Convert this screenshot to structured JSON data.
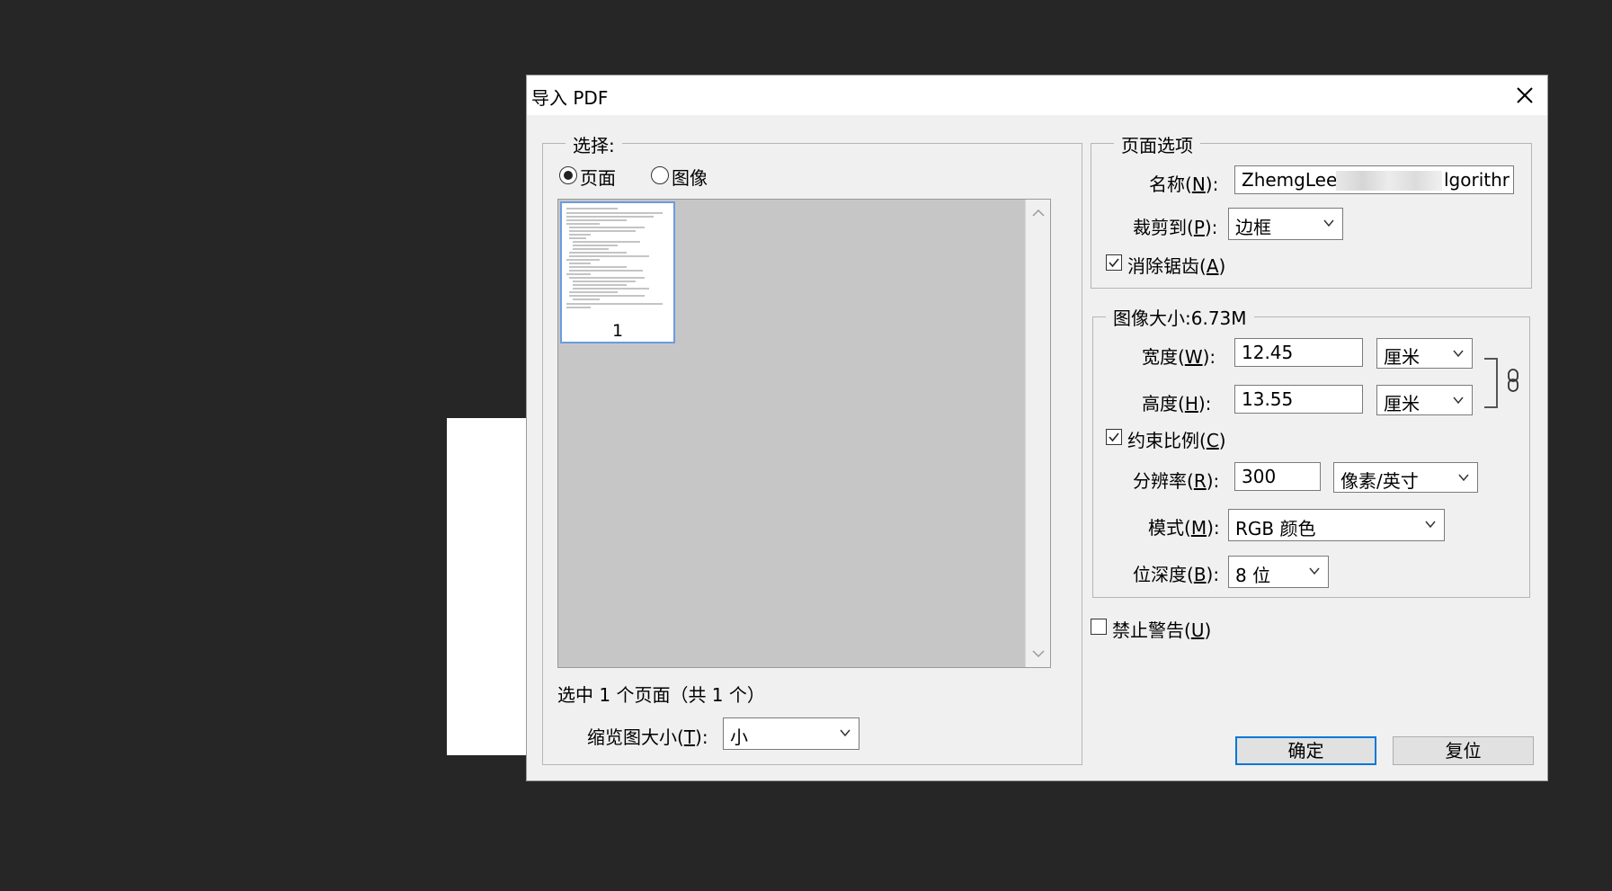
{
  "dialog": {
    "title": "导入 PDF",
    "close_label": "✕"
  },
  "selection": {
    "group_title": "选择:",
    "radio_pages": "页面",
    "radio_images": "图像",
    "selected_mode": "pages",
    "thumbnail_page_number": "1",
    "status_text": "选中 1 个页面（共 1 个）",
    "thumb_size_label_prefix": "缩览图大小(",
    "thumb_size_label_key": "T",
    "thumb_size_label_suffix": "):",
    "thumb_size_value": "小"
  },
  "page_options": {
    "group_title": "页面选项",
    "name_label_prefix": "名称(",
    "name_label_key": "N",
    "name_label_suffix": "):",
    "name_value": "ZhemgLee_",
    "name_value_tail": "lgorithr",
    "crop_label_prefix": "裁剪到(",
    "crop_label_key": "P",
    "crop_label_suffix": "):",
    "crop_value": "边框",
    "antialias_label_prefix": "消除锯齿(",
    "antialias_label_key": "A",
    "antialias_label_suffix": ")",
    "antialias_checked": true
  },
  "image_size": {
    "group_title": "图像大小:6.73M",
    "width_label_prefix": "宽度(",
    "width_label_key": "W",
    "width_label_suffix": "):",
    "width_value": "12.45",
    "width_unit": "厘米",
    "height_label_prefix": "高度(",
    "height_label_key": "H",
    "height_label_suffix": "):",
    "height_value": "13.55",
    "height_unit": "厘米",
    "constrain_label_prefix": "约束比例(",
    "constrain_label_key": "C",
    "constrain_label_suffix": ")",
    "constrain_checked": true,
    "resolution_label_prefix": "分辨率(",
    "resolution_label_key": "R",
    "resolution_label_suffix": "):",
    "resolution_value": "300",
    "resolution_unit": "像素/英寸",
    "mode_label_prefix": "模式(",
    "mode_label_key": "M",
    "mode_label_suffix": "):",
    "mode_value": "RGB 颜色",
    "depth_label_prefix": "位深度(",
    "depth_label_key": "B",
    "depth_label_suffix": "):",
    "depth_value": "8 位"
  },
  "suppress_warnings": {
    "label_prefix": "禁止警告(",
    "label_key": "U",
    "label_suffix": ")",
    "checked": false
  },
  "buttons": {
    "ok": "确定",
    "reset": "复位"
  },
  "colors": {
    "dialog_bg": "#f0f0f0",
    "preview_bg": "#c6c6c6",
    "accent": "#0078d7",
    "desktop_bg": "#262626"
  }
}
